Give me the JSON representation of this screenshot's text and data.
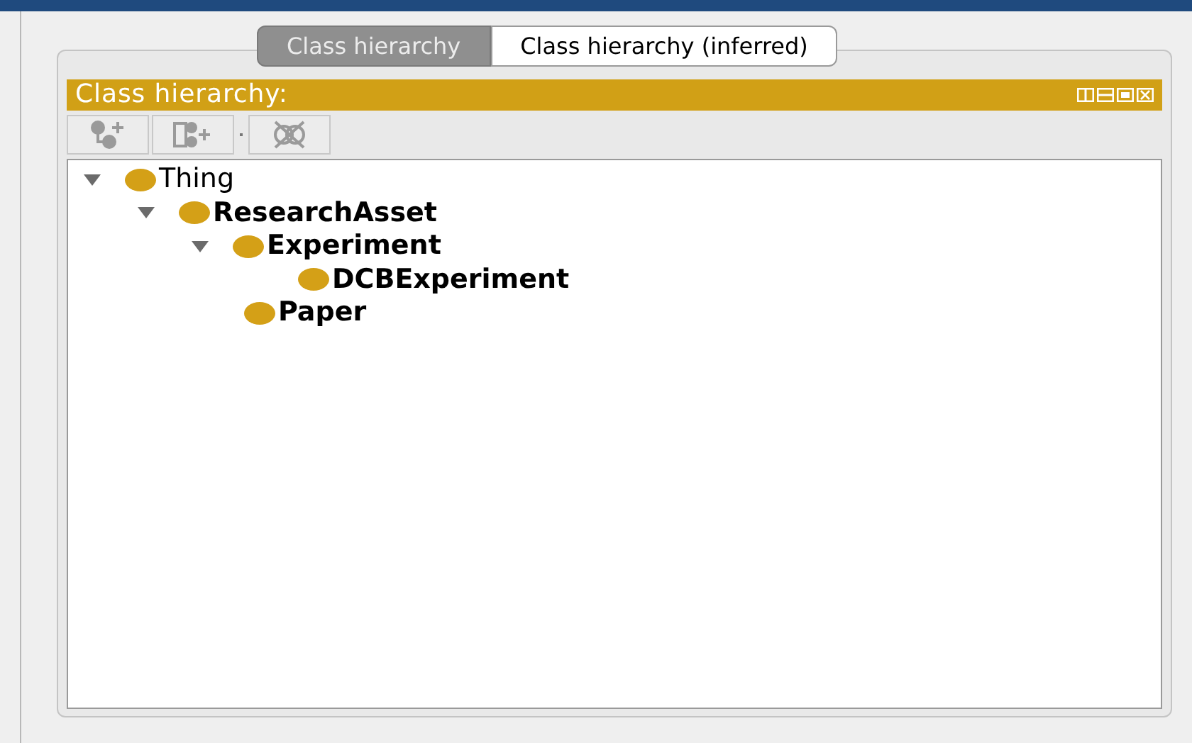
{
  "tabs": [
    {
      "label": "Class hierarchy",
      "selected": true
    },
    {
      "label": "Class hierarchy (inferred)",
      "selected": false
    }
  ],
  "panel": {
    "title": "Class hierarchy:"
  },
  "tree": [
    {
      "label": "Thing",
      "bold": false,
      "expanded": true,
      "children": [
        {
          "label": "ResearchAsset",
          "bold": true,
          "expanded": true,
          "children": [
            {
              "label": "Experiment",
              "bold": true,
              "expanded": true,
              "children": [
                {
                  "label": "DCBExperiment",
                  "bold": true
                }
              ]
            },
            {
              "label": "Paper",
              "bold": true
            }
          ]
        }
      ]
    }
  ]
}
